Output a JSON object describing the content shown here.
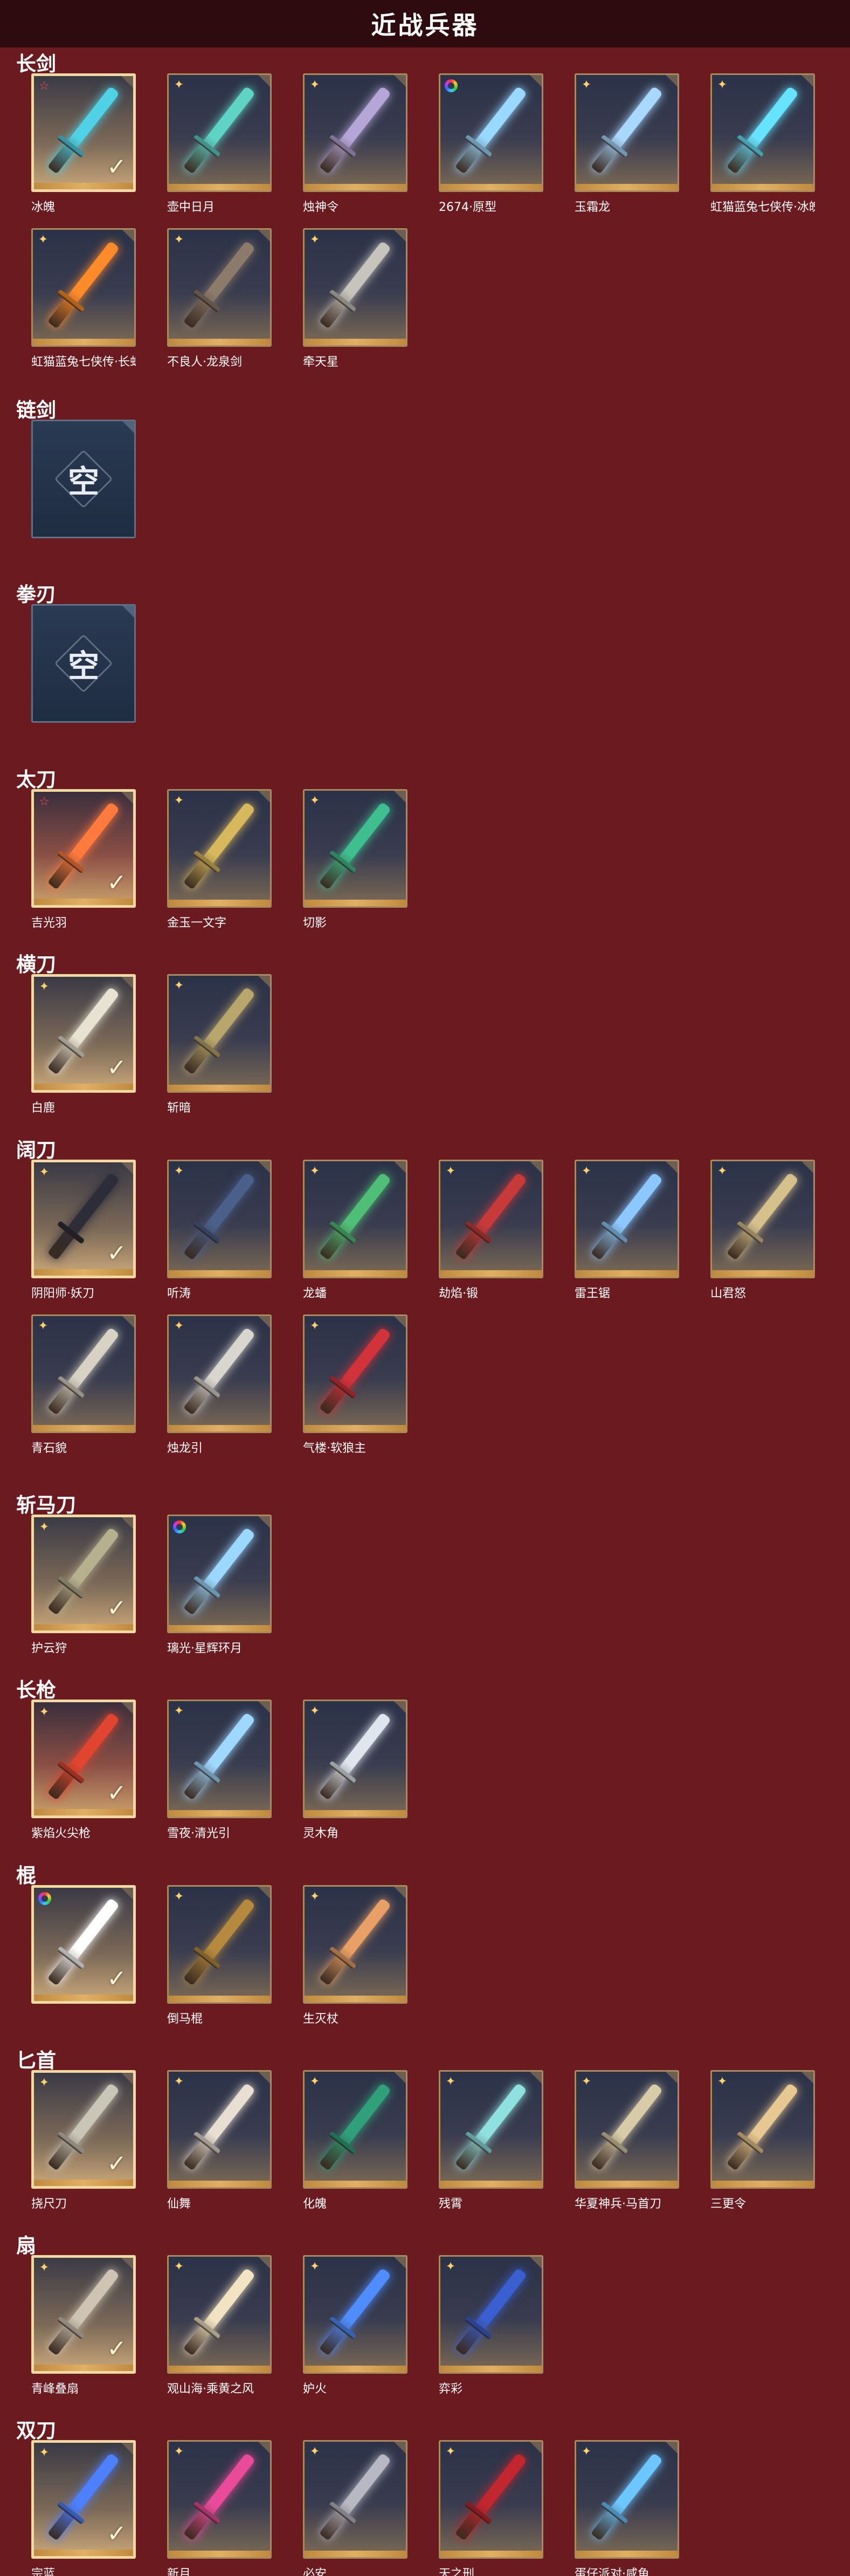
{
  "header": {
    "title": "近战兵器"
  },
  "empty_label": "空",
  "sections": [
    {
      "title": "长剑",
      "items": [
        {
          "name": "冰魄",
          "badge": "redstar",
          "selected": true,
          "tone": "gold",
          "color": "#4fd2e6"
        },
        {
          "name": "壶中日月",
          "badge": "star",
          "color": "#5fd3c6"
        },
        {
          "name": "烛神令",
          "badge": "star",
          "color": "#b6a6d8"
        },
        {
          "name": "2674·原型",
          "badge": "rainbow",
          "color": "#9ad9ff"
        },
        {
          "name": "玉霜龙",
          "badge": "star",
          "color": "#a9d8ff"
        },
        {
          "name": "虹猫蓝兔七侠传·冰魄剑",
          "badge": "star",
          "color": "#66e3ff"
        },
        {
          "name": "虹猫蓝兔七侠传·长虹剑",
          "badge": "star",
          "color": "#ff8a2a"
        },
        {
          "name": "不良人·龙泉剑",
          "badge": "star",
          "color": "#8c7a6a"
        },
        {
          "name": "牵天星",
          "badge": "star",
          "color": "#c7c3bd"
        }
      ]
    },
    {
      "title": "链剑",
      "items": [
        {
          "empty": true
        }
      ]
    },
    {
      "title": "拳刃",
      "items": [
        {
          "empty": true
        }
      ]
    },
    {
      "title": "太刀",
      "items": [
        {
          "name": "吉光羽",
          "badge": "redstar",
          "selected": true,
          "tone": "red",
          "color": "#ff7a3c"
        },
        {
          "name": "金玉一文字",
          "badge": "star",
          "color": "#d8b85c"
        },
        {
          "name": "切影",
          "badge": "star",
          "color": "#3fbf8f"
        }
      ]
    },
    {
      "title": "横刀",
      "items": [
        {
          "name": "白鹿",
          "badge": "star",
          "selected": true,
          "tone": "gold",
          "color": "#e8e2d2"
        },
        {
          "name": "斩暗",
          "badge": "star",
          "color": "#b9a66c"
        }
      ]
    },
    {
      "title": "阔刀",
      "items": [
        {
          "name": "阴阳师·妖刀",
          "badge": "star",
          "selected": true,
          "tone": "gold",
          "color": "#2d2d3a"
        },
        {
          "name": "听涛",
          "badge": "star",
          "color": "#4a5f8a"
        },
        {
          "name": "龙蟠",
          "badge": "star",
          "color": "#4fbf78"
        },
        {
          "name": "劫焰·锻",
          "badge": "star",
          "color": "#c83a3a"
        },
        {
          "name": "雷王锯",
          "badge": "star",
          "color": "#8cc8ff"
        },
        {
          "name": "山君怒",
          "badge": "star",
          "color": "#d6c18c"
        },
        {
          "name": "青石貌",
          "badge": "star",
          "color": "#d8d2c4"
        },
        {
          "name": "烛龙引",
          "badge": "star",
          "color": "#d9d6d0"
        },
        {
          "name": "气楼·软狼主",
          "badge": "star",
          "color": "#d2323a"
        }
      ]
    },
    {
      "title": "斩马刀",
      "items": [
        {
          "name": "护云狩",
          "badge": "star",
          "selected": true,
          "tone": "gold",
          "color": "#b7b08f"
        },
        {
          "name": "璃光·星辉环月",
          "badge": "rainbow",
          "color": "#9ad8ff"
        }
      ]
    },
    {
      "title": "长枪",
      "items": [
        {
          "name": "紫焰火尖枪",
          "badge": "star",
          "selected": true,
          "tone": "red",
          "color": "#e2452f"
        },
        {
          "name": "雪夜·清光引",
          "badge": "star",
          "color": "#9fd8ff"
        },
        {
          "name": "灵木角",
          "badge": "star",
          "color": "#dfe6ee"
        }
      ]
    },
    {
      "title": "棍",
      "items": [
        {
          "name": "",
          "badge": "rainbow",
          "selected": true,
          "tone": "gold",
          "color": "#ffffff"
        },
        {
          "name": "倒马棍",
          "badge": "star",
          "color": "#b58a3e"
        },
        {
          "name": "生灭杖",
          "badge": "star",
          "color": "#e8a066"
        }
      ]
    },
    {
      "title": "匕首",
      "items": [
        {
          "name": "挠尺刀",
          "badge": "star",
          "selected": true,
          "tone": "gold",
          "color": "#c9c6b8"
        },
        {
          "name": "仙舞",
          "badge": "star",
          "color": "#e8ded2"
        },
        {
          "name": "化魄",
          "badge": "star",
          "color": "#2fa07a"
        },
        {
          "name": "残霄",
          "badge": "star",
          "color": "#8fe0e0"
        },
        {
          "name": "华夏神兵·马首刀",
          "badge": "star",
          "color": "#d8cba8"
        },
        {
          "name": "三更令",
          "badge": "star",
          "color": "#e8c892"
        }
      ]
    },
    {
      "title": "扇",
      "items": [
        {
          "name": "青峰叠扇",
          "badge": "star",
          "selected": true,
          "tone": "gold",
          "color": "#cfc4b3"
        },
        {
          "name": "观山海·乘黄之风",
          "badge": "star",
          "color": "#f2e3c2"
        },
        {
          "name": "妒火",
          "badge": "star",
          "color": "#4f8dff"
        },
        {
          "name": "弈彩",
          "badge": "star",
          "color": "#3a5fd0"
        }
      ]
    },
    {
      "title": "双刀",
      "items": [
        {
          "name": "宗蓝",
          "badge": "star",
          "selected": true,
          "tone": "gold",
          "color": "#4c80ff"
        },
        {
          "name": "新月",
          "badge": "star",
          "color": "#e94b9a"
        },
        {
          "name": "必安",
          "badge": "star",
          "color": "#b8b8c4"
        },
        {
          "name": "天之刑",
          "badge": "star",
          "color": "#c2262e"
        },
        {
          "name": "蛋仔派对·咸鱼",
          "badge": "star",
          "color": "#6cc6ff"
        }
      ]
    }
  ]
}
